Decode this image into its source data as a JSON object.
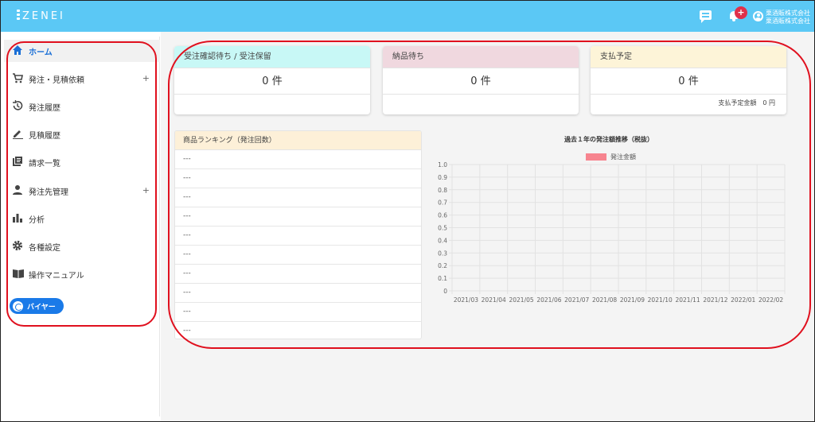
{
  "header": {
    "logo_text": "ZENEI",
    "notification_count": "+",
    "user_line1": "栗酒販株式会社",
    "user_line2": "栗酒販株式会社",
    "bg_color": "#5bc8f5"
  },
  "sidebar": {
    "items": [
      {
        "label": "ホーム",
        "icon": "home-icon",
        "plus": ""
      },
      {
        "label": "発注・見積依頼",
        "icon": "cart-icon",
        "plus": "+"
      },
      {
        "label": "発注履歴",
        "icon": "history-icon",
        "plus": ""
      },
      {
        "label": "見積履歴",
        "icon": "pencil-icon",
        "plus": ""
      },
      {
        "label": "請求一覧",
        "icon": "list-icon",
        "plus": ""
      },
      {
        "label": "発注先管理",
        "icon": "person-icon",
        "plus": "+"
      },
      {
        "label": "分析",
        "icon": "bar-chart-icon",
        "plus": ""
      },
      {
        "label": "各種設定",
        "icon": "gear-icon",
        "plus": ""
      },
      {
        "label": "操作マニュアル",
        "icon": "book-icon",
        "plus": ""
      }
    ],
    "role_button": "バイヤー"
  },
  "cards": [
    {
      "title": "受注確認待ち / 受注保留",
      "count": "0 件",
      "footer": "",
      "color": "#c8f8f6"
    },
    {
      "title": "納品待ち",
      "count": "0 件",
      "footer": "",
      "color": "#f0d8df"
    },
    {
      "title": "支払予定",
      "count": "0 件",
      "footer": "支払予定金額　0 円",
      "color": "#fdf4d8"
    }
  ],
  "ranking": {
    "title": "商品ランキング（発注回数）",
    "rows": [
      "---",
      "---",
      "---",
      "---",
      "---",
      "---",
      "---",
      "---",
      "---",
      "---"
    ]
  },
  "chart_data": {
    "type": "bar",
    "title": "過去１年の発注額推移（税抜）",
    "categories": [
      "2021/03",
      "2021/04",
      "2021/05",
      "2021/06",
      "2021/07",
      "2021/08",
      "2021/09",
      "2021/10",
      "2021/11",
      "2021/12",
      "2022/01",
      "2022/02"
    ],
    "series": [
      {
        "name": "発注金額",
        "values": [
          0,
          0,
          0,
          0,
          0,
          0,
          0,
          0,
          0,
          0,
          0,
          0
        ],
        "color": "#f7848f"
      }
    ],
    "yticks": [
      "0",
      "0.1",
      "0.2",
      "0.3",
      "0.4",
      "0.5",
      "0.6",
      "0.7",
      "0.8",
      "0.9",
      "1.0"
    ],
    "ylim": [
      0,
      1
    ],
    "grid": true,
    "legend": "top"
  }
}
